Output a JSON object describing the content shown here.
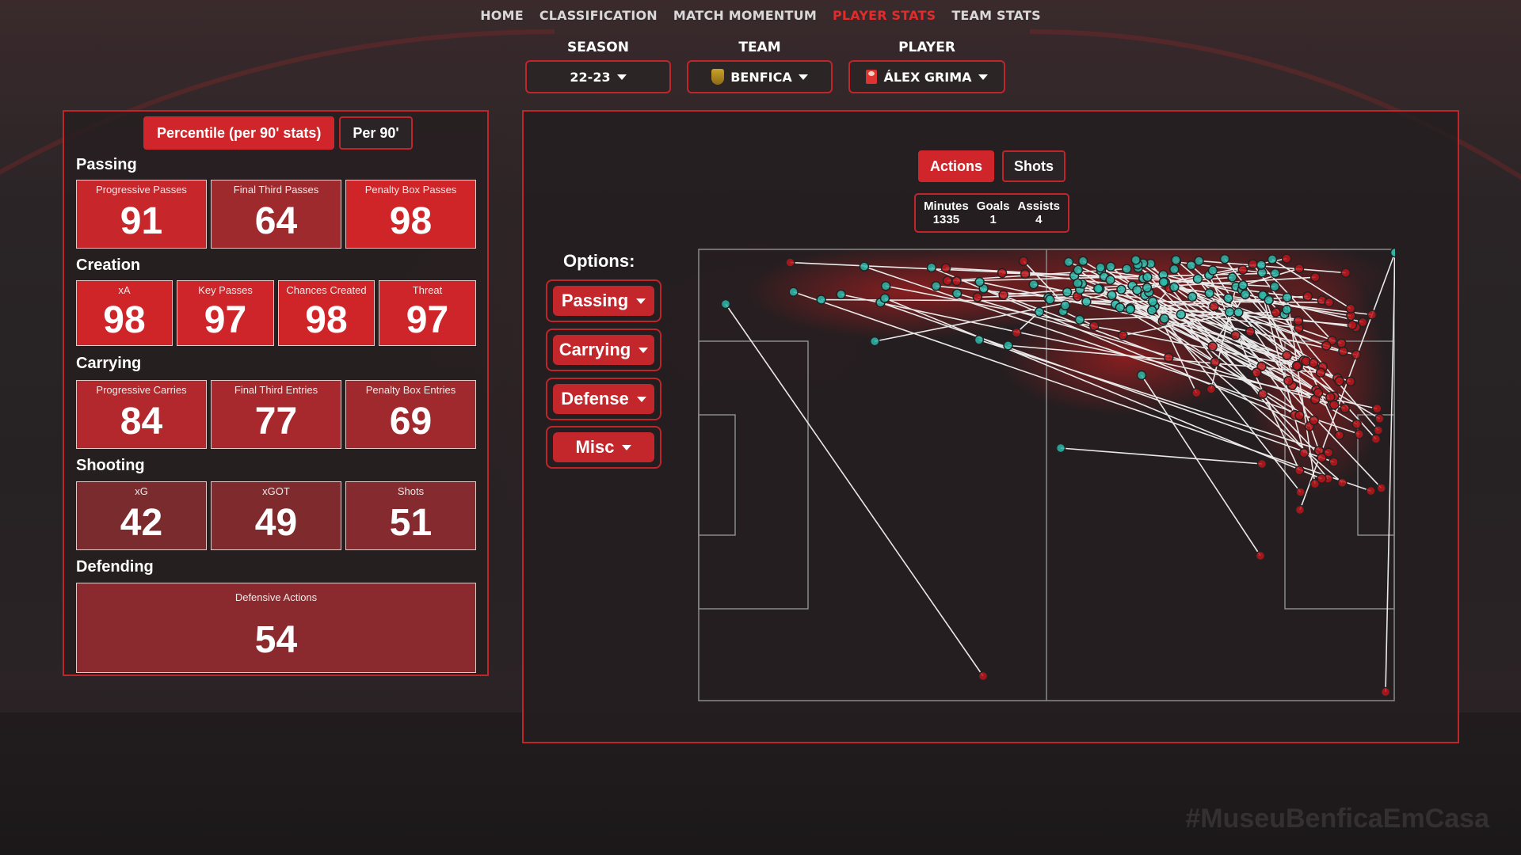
{
  "nav": {
    "items": [
      "HOME",
      "CLASSIFICATION",
      "MATCH MOMENTUM",
      "PLAYER STATS",
      "TEAM STATS"
    ],
    "active": "PLAYER STATS",
    "active_color": "#e32b2b"
  },
  "filters": {
    "season": {
      "label": "SEASON",
      "value": "22-23"
    },
    "team": {
      "label": "TEAM",
      "value": "BENFICA",
      "icon": "benfica-crest-icon"
    },
    "player": {
      "label": "PLAYER",
      "value": "ÁLEX GRIMA",
      "icon": "player-photo-icon"
    }
  },
  "stats_panel": {
    "toggle": {
      "percentile_label": "Percentile (per 90' stats)",
      "per90_label": "Per 90'",
      "active": "percentile"
    },
    "sections": [
      {
        "title": "Passing",
        "cards": [
          {
            "label": "Progressive Passes",
            "value": 91
          },
          {
            "label": "Final Third Passes",
            "value": 64
          },
          {
            "label": "Penalty Box Passes",
            "value": 98
          }
        ]
      },
      {
        "title": "Creation",
        "cards": [
          {
            "label": "xA",
            "value": 98
          },
          {
            "label": "Key Passes",
            "value": 97
          },
          {
            "label": "Chances Created",
            "value": 98
          },
          {
            "label": "Threat",
            "value": 97
          }
        ]
      },
      {
        "title": "Carrying",
        "cards": [
          {
            "label": "Progressive Carries",
            "value": 84
          },
          {
            "label": "Final Third Entries",
            "value": 77
          },
          {
            "label": "Penalty Box Entries",
            "value": 69
          }
        ]
      },
      {
        "title": "Shooting",
        "cards": [
          {
            "label": "xG",
            "value": 42
          },
          {
            "label": "xGOT",
            "value": 49
          },
          {
            "label": "Shots",
            "value": 51
          }
        ]
      },
      {
        "title": "Defending",
        "cards": [
          {
            "label": "Defensive Actions",
            "value": 54
          }
        ]
      }
    ]
  },
  "actions_panel": {
    "tabs": [
      "Actions",
      "Shots"
    ],
    "active_tab": "Actions",
    "summary": [
      {
        "label": "Minutes",
        "value": "1335"
      },
      {
        "label": "Goals",
        "value": "1"
      },
      {
        "label": "Assists",
        "value": "4"
      }
    ],
    "options_label": "Options:",
    "options": [
      "Passing",
      "Carrying",
      "Defense",
      "Misc"
    ]
  },
  "colors": {
    "accent": "#c0252a",
    "start_marker": "#2bb7a9",
    "end_marker": "#b8161c"
  },
  "watermark": "#MuseuBenficaEmCasa"
}
